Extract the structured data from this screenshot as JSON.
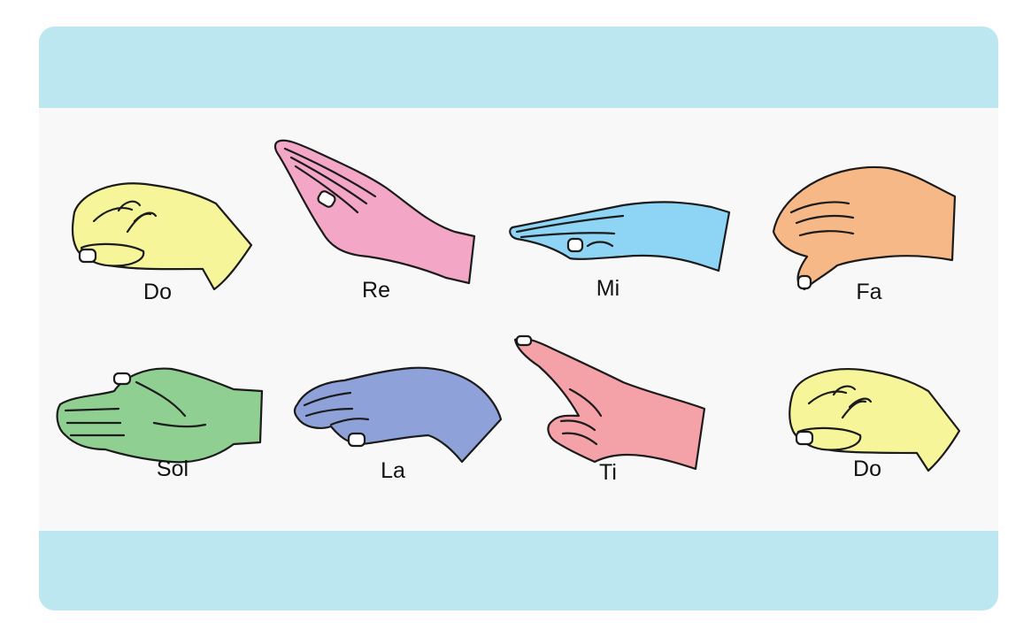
{
  "hand_signs": [
    {
      "label": "Do",
      "color": "#f7f59a"
    },
    {
      "label": "Re",
      "color": "#f3a6c6"
    },
    {
      "label": "Mi",
      "color": "#8ed4f4"
    },
    {
      "label": "Fa",
      "color": "#f7b888"
    },
    {
      "label": "Sol",
      "color": "#8fcf91"
    },
    {
      "label": "La",
      "color": "#8ea1d8"
    },
    {
      "label": "Ti",
      "color": "#f4a2a8"
    },
    {
      "label": "Do",
      "color": "#f7f59a"
    }
  ],
  "colors": {
    "band": "#bde7f0",
    "panel": "#f8f8f8"
  }
}
